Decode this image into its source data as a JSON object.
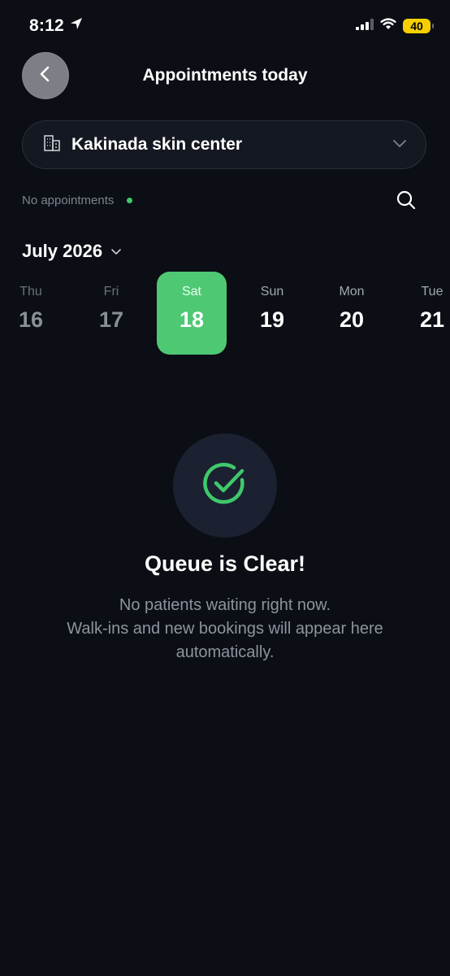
{
  "status_bar": {
    "time": "8:12",
    "battery": "40"
  },
  "header": {
    "title": "Appointments today"
  },
  "clinic": {
    "name": "Kakinada skin center"
  },
  "appointments": {
    "status_text": "No appointments"
  },
  "calendar": {
    "month_label": "July 2026",
    "days": [
      {
        "dow": "Thu",
        "num": "16",
        "state": "past"
      },
      {
        "dow": "Fri",
        "num": "17",
        "state": "past"
      },
      {
        "dow": "Sat",
        "num": "18",
        "state": "selected"
      },
      {
        "dow": "Sun",
        "num": "19",
        "state": "future"
      },
      {
        "dow": "Mon",
        "num": "20",
        "state": "future"
      },
      {
        "dow": "Tue",
        "num": "21",
        "state": "future"
      }
    ]
  },
  "empty_state": {
    "title": "Queue is Clear!",
    "line1": "No patients waiting right now.",
    "line2": "Walk-ins and new bookings will appear here",
    "line3": "automatically."
  },
  "colors": {
    "background": "#0b0e15",
    "accent": "#4fc874",
    "battery": "#f5d000"
  }
}
